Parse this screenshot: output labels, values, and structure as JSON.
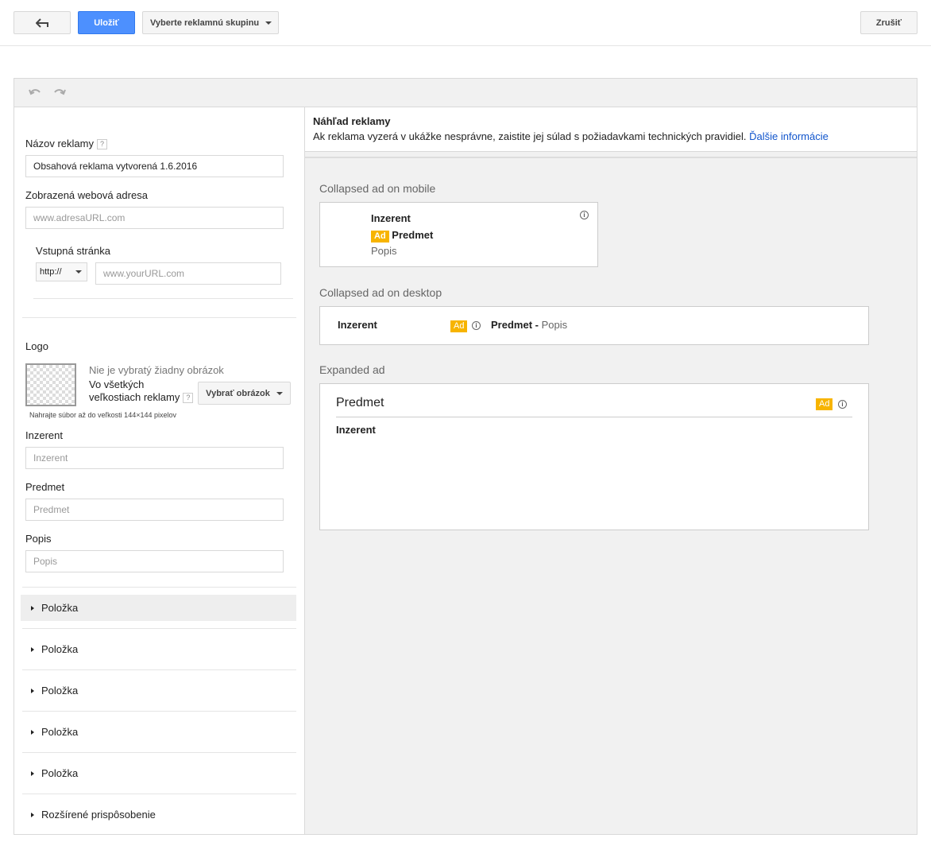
{
  "toolbar": {
    "save_label": "Uložiť",
    "adgroup_label": "Vyberte reklamnú skupinu",
    "cancel_label": "Zrušiť"
  },
  "form": {
    "ad_name_label": "Názov reklamy",
    "ad_name_value": "Obsahová reklama vytvorená 1.6.2016",
    "display_url_label": "Zobrazená webová adresa",
    "display_url_placeholder": "www.adresaURL.com",
    "landing_label": "Vstupná stránka",
    "protocol_value": "http://",
    "landing_placeholder": "www.yourURL.com",
    "logo_label": "Logo",
    "no_image_text": "Nie je vybratý žiadny obrázok",
    "all_sizes_text_1": "Vo všetkých",
    "all_sizes_text_2": "veľkostiach reklamy",
    "select_image_label": "Vybrať obrázok",
    "upload_hint": "Nahrajte súbor až do veľkosti 144×144 pixelov",
    "advertiser_label": "Inzerent",
    "advertiser_placeholder": "Inzerent",
    "subject_label": "Predmet",
    "subject_placeholder": "Predmet",
    "description_label": "Popis",
    "description_placeholder": "Popis",
    "items": [
      "Položka",
      "Položka",
      "Položka",
      "Položka",
      "Položka"
    ],
    "advanced_label": "Rozšírené prispôsobenie",
    "help_mark": "?"
  },
  "preview": {
    "title": "Náhľad reklamy",
    "subtitle": "Ak reklama vyzerá v ukážke nesprávne, zaistite jej súlad s požiadavkami technických pravidiel.",
    "more_info": "Ďalšie informácie",
    "mobile_label": "Collapsed ad on mobile",
    "desktop_label": "Collapsed ad on desktop",
    "expanded_label": "Expanded ad",
    "advertiser": "Inzerent",
    "subject": "Predmet",
    "description": "Popis",
    "ad_badge": "Ad",
    "separator": "-",
    "info_glyph": "i",
    "badge_color": "#f7b400"
  }
}
